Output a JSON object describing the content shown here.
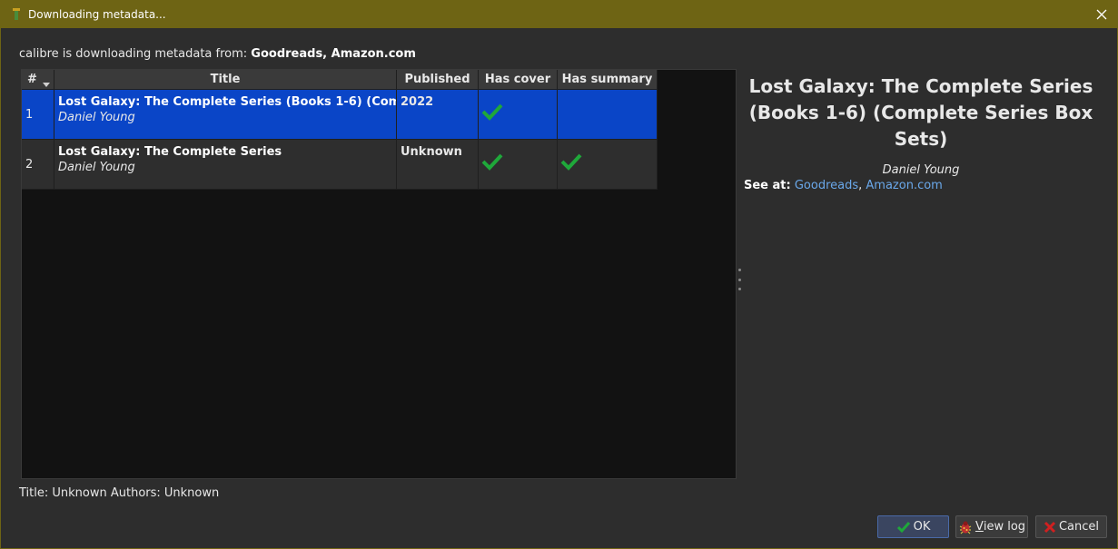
{
  "window": {
    "title": "Downloading metadata..."
  },
  "status": {
    "prefix": "calibre is downloading metadata from: ",
    "sources": "Goodreads, Amazon.com"
  },
  "table": {
    "columns": [
      "#",
      "Title",
      "Published",
      "Has cover",
      "Has summary"
    ],
    "rows": [
      {
        "num": "1",
        "title": "Lost Galaxy: The Complete Series (Books 1-6) (Complete Series Box Sets)",
        "author": "Daniel Young",
        "published": "2022",
        "has_cover": true,
        "has_summary": false,
        "selected": true
      },
      {
        "num": "2",
        "title": "Lost Galaxy: The Complete Series",
        "author": "Daniel Young",
        "published": "Unknown",
        "has_cover": true,
        "has_summary": true,
        "selected": false
      }
    ]
  },
  "details": {
    "title": "Lost Galaxy: The Complete Series (Books 1-6) (Complete Series Box Sets)",
    "author": "Daniel Young",
    "see_at_label": "See at:",
    "links": [
      "Goodreads",
      "Amazon.com"
    ],
    "link_sep": ", "
  },
  "footer": {
    "status": "Title: Unknown Authors: Unknown"
  },
  "buttons": {
    "ok": "OK",
    "view_log_first": "V",
    "view_log_rest": "iew log",
    "cancel": "Cancel"
  },
  "colors": {
    "titlebar": "#6e6414",
    "selected_row": "#0a45c7",
    "check": "#1fa83a",
    "link": "#6aa8ea"
  }
}
